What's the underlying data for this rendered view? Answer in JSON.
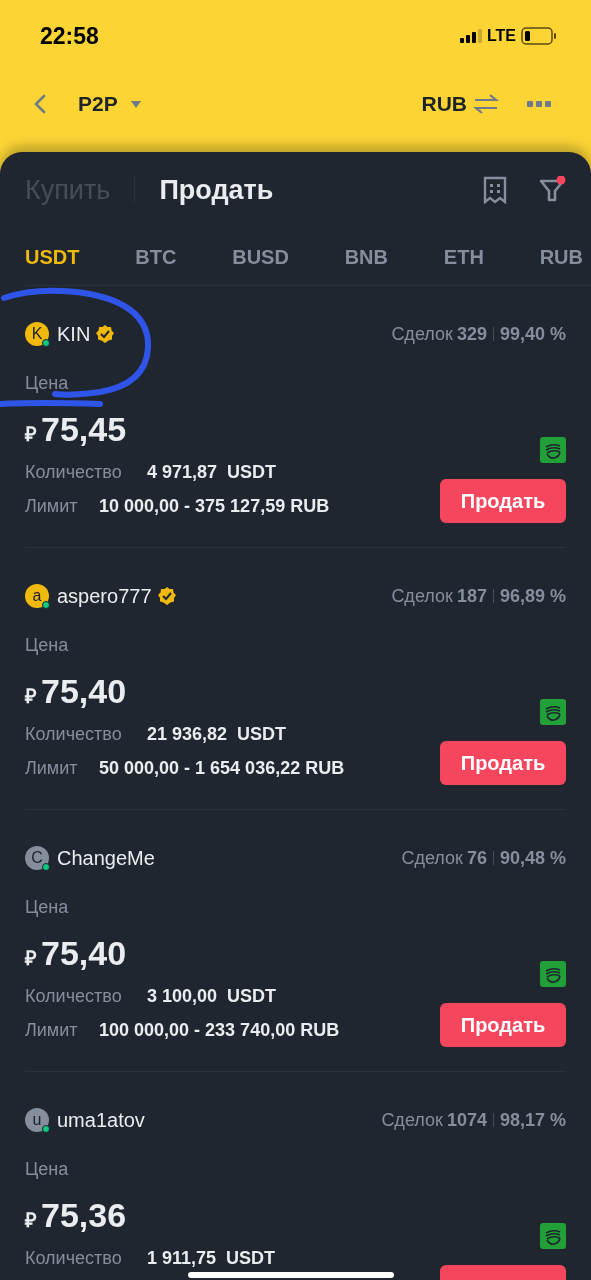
{
  "status_bar": {
    "time": "22:58",
    "network": "LTE"
  },
  "header": {
    "title": "P2P",
    "currency": "RUB"
  },
  "trade_tabs": [
    {
      "label": "Купить",
      "selected": false
    },
    {
      "label": "Продать",
      "selected": true
    }
  ],
  "filter_active": true,
  "coin_tabs": [
    {
      "label": "USDT",
      "selected": true
    },
    {
      "label": "BTC",
      "selected": false
    },
    {
      "label": "BUSD",
      "selected": false
    },
    {
      "label": "BNB",
      "selected": false
    },
    {
      "label": "ETH",
      "selected": false
    },
    {
      "label": "RUB",
      "selected": false
    }
  ],
  "offers": [
    {
      "initial": "K",
      "name": "KIN",
      "color": "#f0b90b",
      "verified": true,
      "online": true,
      "deals_label": "Сделок",
      "deals": "329",
      "rate": "99,40 %",
      "price_label": "Цена",
      "currency_sign": "₽",
      "price": "75,45",
      "quantity_label": "Количество",
      "quantity": "4 971,87",
      "quantity_unit": "USDT",
      "limit_label": "Лимит",
      "limit": "10 000,00 - 375 127,59 RUB",
      "action": "Продать"
    },
    {
      "initial": "a",
      "name": "aspero777",
      "color": "#f0b90b",
      "verified": true,
      "online": true,
      "deals_label": "Сделок",
      "deals": "187",
      "rate": "96,89 %",
      "price_label": "Цена",
      "currency_sign": "₽",
      "price": "75,40",
      "quantity_label": "Количество",
      "quantity": "21 936,82",
      "quantity_unit": "USDT",
      "limit_label": "Лимит",
      "limit": "50 000,00 - 1 654 036,22 RUB",
      "action": "Продать"
    },
    {
      "initial": "C",
      "name": "ChangeMe",
      "color": "#848e9c",
      "verified": false,
      "online": true,
      "deals_label": "Сделок",
      "deals": "76",
      "rate": "90,48 %",
      "price_label": "Цена",
      "currency_sign": "₽",
      "price": "75,40",
      "quantity_label": "Количество",
      "quantity": "3 100,00",
      "quantity_unit": "USDT",
      "limit_label": "Лимит",
      "limit": "100 000,00 - 233 740,00 RUB",
      "action": "Продать"
    },
    {
      "initial": "u",
      "name": "uma1atov",
      "color": "#848e9c",
      "verified": false,
      "online": true,
      "deals_label": "Сделок",
      "deals": "1074",
      "rate": "98,17 %",
      "price_label": "Цена",
      "currency_sign": "₽",
      "price": "75,36",
      "quantity_label": "Количество",
      "quantity": "1 911,75",
      "quantity_unit": "USDT"
    }
  ]
}
